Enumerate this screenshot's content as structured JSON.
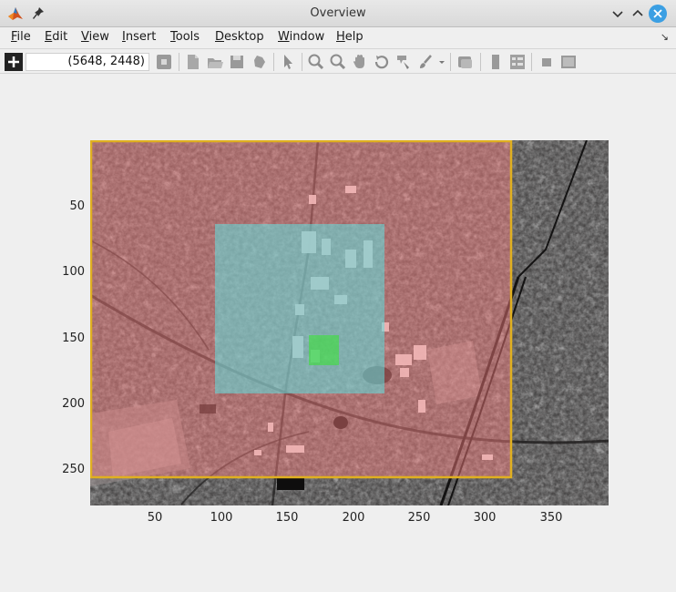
{
  "window": {
    "title": "Overview"
  },
  "menu": {
    "items": [
      {
        "label": "File",
        "u": "F",
        "rest": "ile"
      },
      {
        "label": "Edit",
        "u": "E",
        "rest": "dit"
      },
      {
        "label": "View",
        "u": "V",
        "rest": "iew"
      },
      {
        "label": "Insert",
        "u": "I",
        "rest": "nsert"
      },
      {
        "label": "Tools",
        "u": "T",
        "rest": "ools"
      },
      {
        "label": "Desktop",
        "u": "D",
        "rest": "esktop"
      },
      {
        "label": "Window",
        "u": "W",
        "rest": "indow"
      },
      {
        "label": "Help",
        "u": "H",
        "rest": "elp"
      }
    ]
  },
  "toolbar": {
    "coordinate_readout": "(5648, 2448)"
  },
  "axes": {
    "y_ticks": [
      "50",
      "100",
      "150",
      "200",
      "250"
    ],
    "x_ticks": [
      "50",
      "100",
      "150",
      "200",
      "250",
      "300",
      "350"
    ]
  },
  "overlay": {
    "yellow_rect_color": "#e0b020",
    "red_tint_color": "#ff8080",
    "cyan_tint_color": "#60e0e0",
    "green_tint_color": "#40dd40"
  }
}
